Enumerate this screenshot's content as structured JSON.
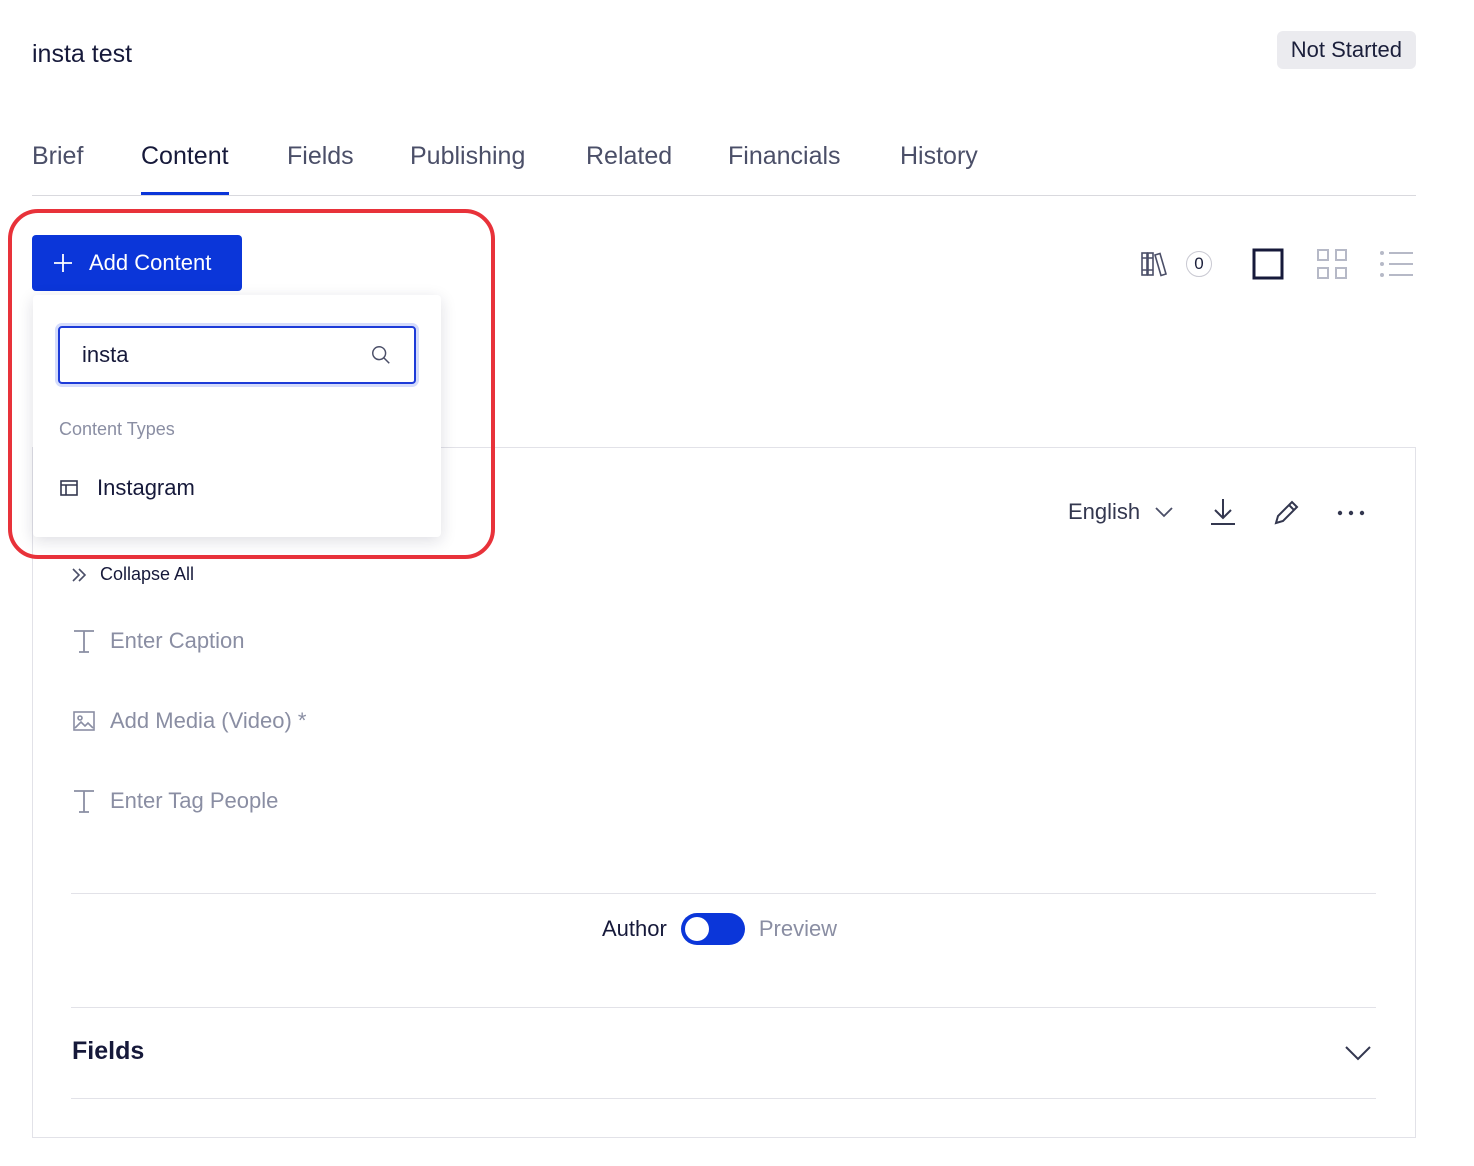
{
  "header": {
    "title": "insta test",
    "status": "Not Started"
  },
  "tabs": [
    {
      "label": "Brief"
    },
    {
      "label": "Content",
      "active": true
    },
    {
      "label": "Fields"
    },
    {
      "label": "Publishing"
    },
    {
      "label": "Related"
    },
    {
      "label": "Financials"
    },
    {
      "label": "History"
    }
  ],
  "toolbar": {
    "add_content_label": "Add Content",
    "library_count": "0",
    "icons": [
      "library-icon",
      "single-view-icon",
      "grid-view-icon",
      "list-view-icon"
    ]
  },
  "dropdown": {
    "search_value": "insta",
    "section_label": "Content Types",
    "items": [
      {
        "label": "Instagram",
        "icon": "layout-icon"
      }
    ]
  },
  "editor": {
    "language": "English",
    "collapse_all_label": "Collapse All",
    "fields": [
      {
        "label": "Enter Caption",
        "icon": "text-icon"
      },
      {
        "label": "Add Media (Video) *",
        "icon": "image-icon"
      },
      {
        "label": "Enter Tag People",
        "icon": "text-icon"
      }
    ],
    "toggle": {
      "left_label": "Author",
      "right_label": "Preview",
      "state": "Author"
    },
    "fields_section_title": "Fields"
  },
  "colors": {
    "accent": "#0b36d9",
    "highlight": "#e8323a",
    "muted": "#8a8ea3"
  }
}
